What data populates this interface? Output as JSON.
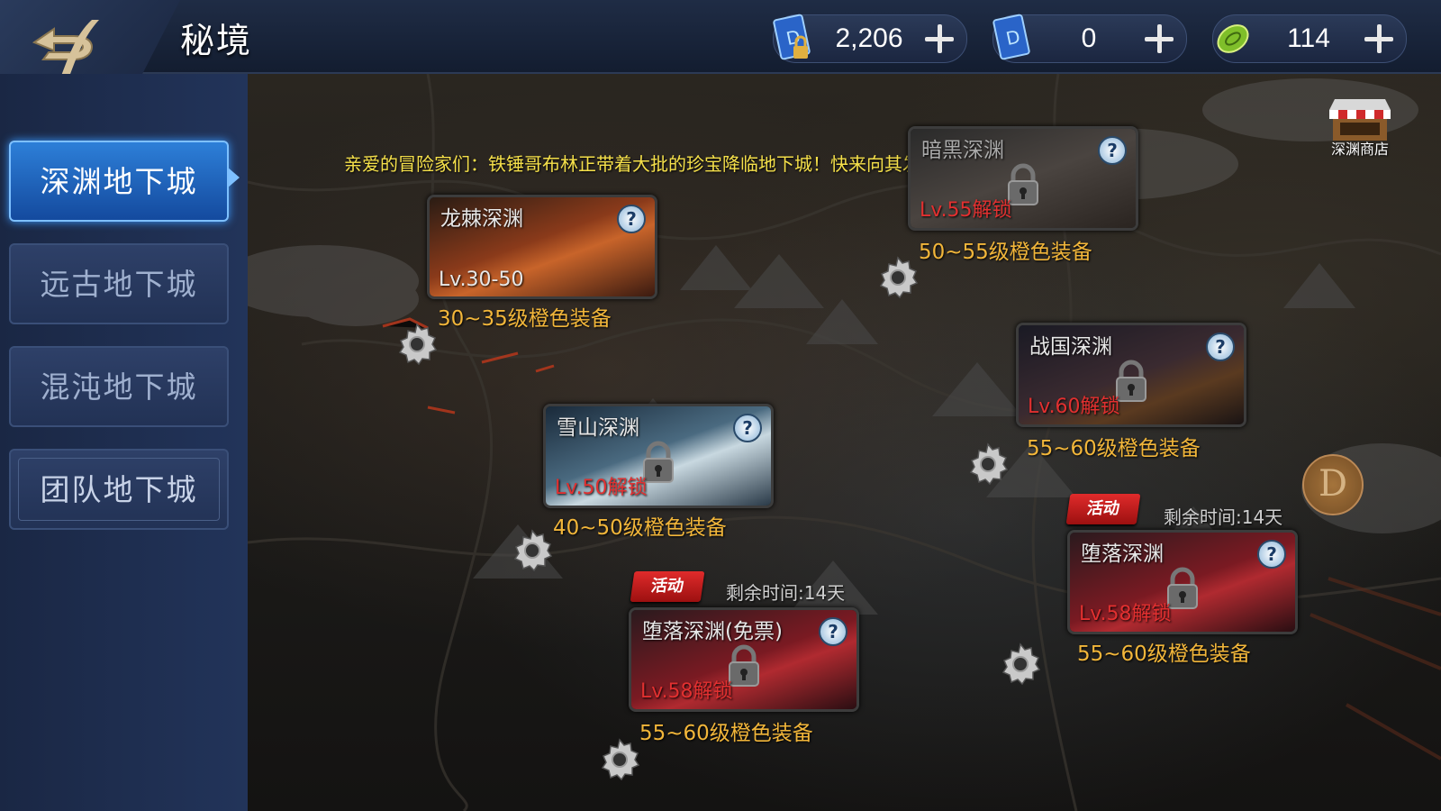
{
  "header": {
    "title": "秘境",
    "back_icon": "back-arrow-d-icon",
    "currencies": [
      {
        "icon": "locked-ticket-icon",
        "value": "2,206"
      },
      {
        "icon": "ticket-icon",
        "value": "0"
      },
      {
        "icon": "gold-coin-icon",
        "value": "114"
      }
    ]
  },
  "sidebar": {
    "items": [
      {
        "label": "深渊地下城",
        "active": true
      },
      {
        "label": "远古地下城",
        "active": false
      },
      {
        "label": "混沌地下城",
        "active": false
      },
      {
        "label": "团队地下城",
        "active": false
      }
    ]
  },
  "map": {
    "notice": "亲爱的冒险家们：铁锤哥布林正带着大批的珍宝降临地下城！快来向其发起挑战吧！成功即可",
    "shop_label": "深渊商店",
    "side_coin": "D",
    "dungeons": [
      {
        "name": "龙棘深渊",
        "level": "Lv.30-50",
        "locked": false,
        "reward": "30~35级橙色装备"
      },
      {
        "name": "暗黑深渊",
        "level": "Lv.55解锁",
        "locked": true,
        "reward": "50~55级橙色装备"
      },
      {
        "name": "战国深渊",
        "level": "Lv.60解锁",
        "locked": true,
        "reward": "55~60级橙色装备"
      },
      {
        "name": "雪山深渊",
        "level": "Lv.50解锁",
        "locked": true,
        "reward": "40~50级橙色装备"
      },
      {
        "name": "堕落深渊(免票)",
        "level": "Lv.58解锁",
        "locked": true,
        "reward": "55~60级橙色装备",
        "event": "活动",
        "event_time": "剩余时间:14天"
      },
      {
        "name": "堕落深渊",
        "level": "Lv.58解锁",
        "locked": true,
        "reward": "55~60级橙色装备",
        "event": "活动",
        "event_time": "剩余时间:14天"
      }
    ],
    "help_glyph": "?"
  },
  "colors": {
    "active_tab": "#2d7fd8",
    "reward_text": "#f2b63a",
    "locked_level": "#e23030",
    "notice_text": "#f5e04a"
  }
}
